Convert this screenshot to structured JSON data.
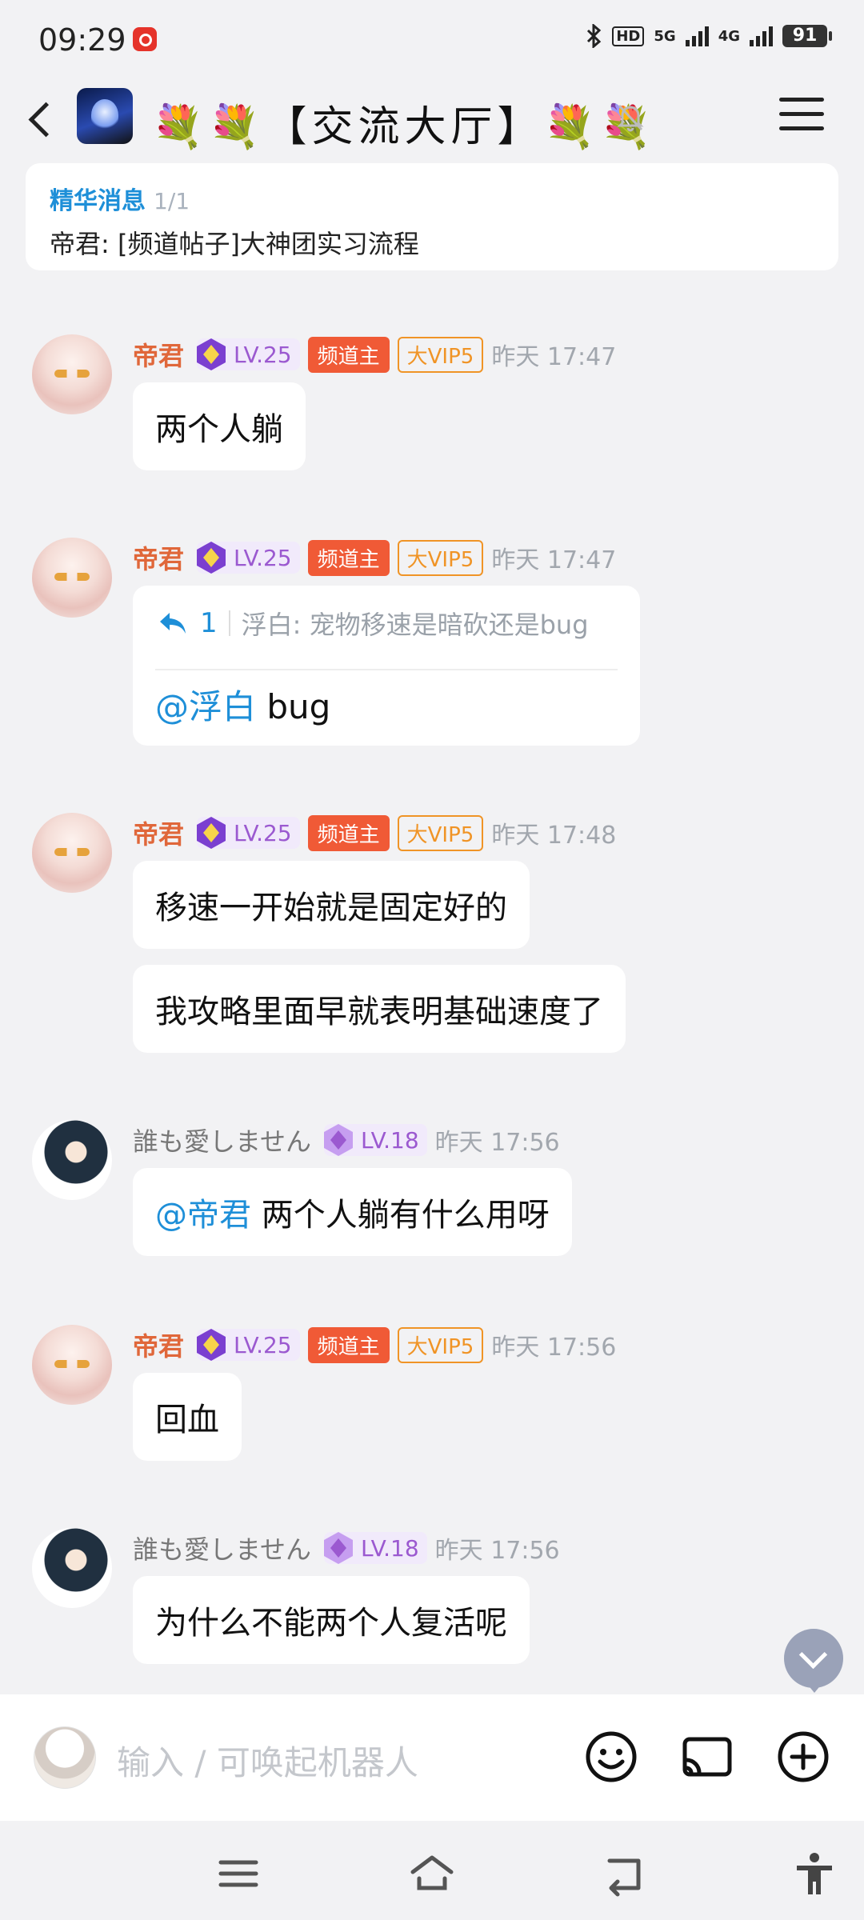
{
  "status_bar": {
    "time": "09:29",
    "network_hd": "HD",
    "net_5g": "5G",
    "net_4g": "4G",
    "battery": "91"
  },
  "header": {
    "title": "💐💐【交流大厅】💐💐"
  },
  "pinned": {
    "label": "精华消息",
    "count": "1/1",
    "text": "帝君: [频道帖子]大神团实习流程"
  },
  "messages": [
    {
      "user": "帝君",
      "level": "LV.25",
      "role": "频道主",
      "vip": "大VIP5",
      "time": "昨天 17:47",
      "text": "两个人躺"
    },
    {
      "user": "帝君",
      "level": "LV.25",
      "role": "频道主",
      "vip": "大VIP5",
      "time": "昨天 17:47",
      "reply_count": "1",
      "reply_quote": "浮白: 宠物移速是暗砍还是bug",
      "mention": "@浮白",
      "text": " bug"
    },
    {
      "user": "帝君",
      "level": "LV.25",
      "role": "频道主",
      "vip": "大VIP5",
      "time": "昨天 17:48",
      "text": "移速一开始就是固定好的",
      "text2": "我攻略里面早就表明基础速度了"
    },
    {
      "user": "誰も愛しません",
      "level": "LV.18",
      "time": "昨天 17:56",
      "mention": "@帝君",
      "text": " 两个人躺有什么用呀"
    },
    {
      "user": "帝君",
      "level": "LV.25",
      "role": "频道主",
      "vip": "大VIP5",
      "time": "昨天 17:56",
      "text": "回血"
    },
    {
      "user": "誰も愛しません",
      "level": "LV.18",
      "time": "昨天 17:56",
      "text": "为什么不能两个人复活呢"
    }
  ],
  "input": {
    "placeholder": "输入 / 可唤起机器人"
  },
  "colors": {
    "accent_blue": "#1e8fd8",
    "host_badge": "#f05a36",
    "vip_badge": "#f09426",
    "username": "#e0673a",
    "level": "#9b59d0"
  }
}
